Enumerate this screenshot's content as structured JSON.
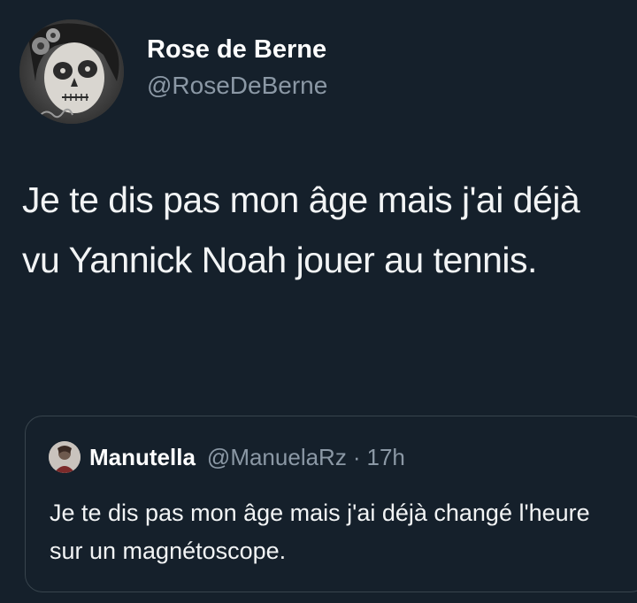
{
  "tweet": {
    "author": {
      "display_name": "Rose de Berne",
      "handle": "@RoseDeBerne",
      "avatar_icon": "sugar-skull-portrait-avatar"
    },
    "text": "Je te dis pas mon âge mais j'ai déjà vu Yannick Noah jouer au tennis."
  },
  "quoted_tweet": {
    "author": {
      "display_name": "Manutella",
      "handle": "@ManuelaRz",
      "avatar_icon": "photo-avatar"
    },
    "separator": "·",
    "time": "17h",
    "text": "Je te dis pas mon âge mais j'ai déjà changé l'heure sur un magnétoscope."
  },
  "colors": {
    "background": "#15202b",
    "primary_text": "#ffffff",
    "secondary_text": "#8b98a5",
    "border": "#38444d"
  }
}
